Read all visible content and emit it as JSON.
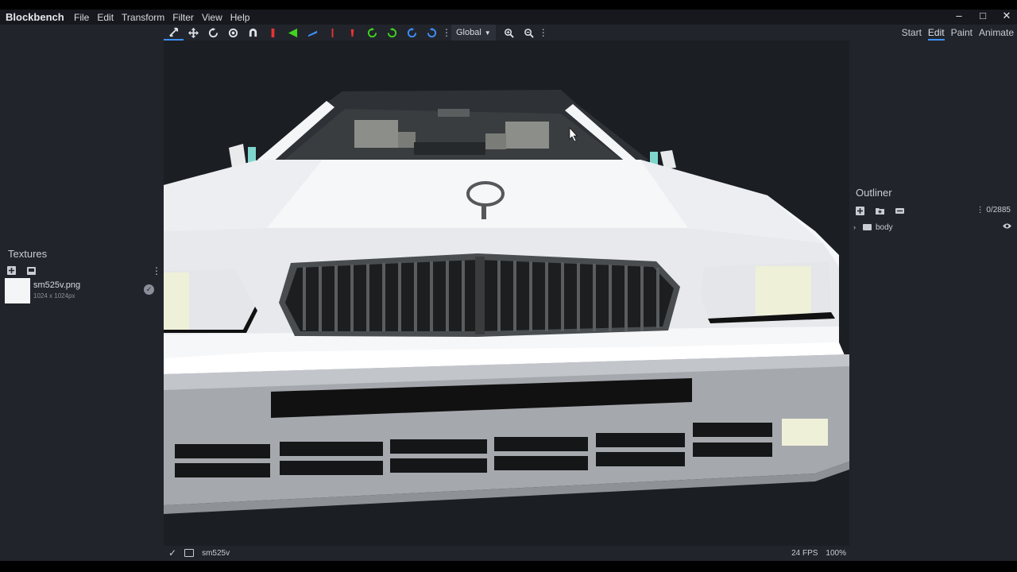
{
  "app": {
    "title": "Blockbench",
    "menu": [
      "File",
      "Edit",
      "Transform",
      "Filter",
      "View",
      "Help"
    ]
  },
  "window_controls": [
    "minimize-icon",
    "maximize-icon",
    "close-icon"
  ],
  "toolbar": {
    "tools": [
      {
        "icon": "move-tool-icon",
        "active": true
      },
      {
        "icon": "pivot-move-icon",
        "active": false
      },
      {
        "icon": "rotate-tool-icon",
        "active": false
      },
      {
        "icon": "pivot-tool-icon",
        "active": false
      },
      {
        "icon": "vertex-snap-icon",
        "active": false
      },
      {
        "icon": "move-x-icon",
        "color": "#e63434"
      },
      {
        "icon": "move-y-icon",
        "color": "#42d31e"
      },
      {
        "icon": "move-z-icon",
        "color": "#3e90ff"
      },
      {
        "icon": "rotate-x-icon",
        "color": "#e63434"
      },
      {
        "icon": "rotate-x2-icon",
        "color": "#e63434"
      },
      {
        "icon": "rotate-y-icon",
        "color": "#42d31e"
      },
      {
        "icon": "rotate-y2-icon",
        "color": "#42d31e"
      },
      {
        "icon": "rotate-z-icon",
        "color": "#3e90ff"
      },
      {
        "icon": "rotate-z2-icon",
        "color": "#3e90ff"
      }
    ],
    "space_select": "Global",
    "zoom_in_icon": "zoom-in-icon",
    "zoom_out_icon": "zoom-out-icon"
  },
  "modes": {
    "start": "Start",
    "edit": "Edit",
    "paint": "Paint",
    "animate": "Animate",
    "active": "Edit"
  },
  "textures": {
    "title": "Textures",
    "items": [
      {
        "name": "sm525v.png",
        "size": "1024 x 1024px"
      }
    ]
  },
  "outliner": {
    "title": "Outliner",
    "count": "0/2885",
    "items": [
      {
        "name": "body",
        "type": "group"
      }
    ]
  },
  "status": {
    "model_name": "sm525v",
    "fps": "24 FPS",
    "zoom": "100%"
  },
  "colors": {
    "accent": "#3e90ff",
    "viewport_bg": "#1b1e23",
    "panel_bg": "#21252b"
  }
}
